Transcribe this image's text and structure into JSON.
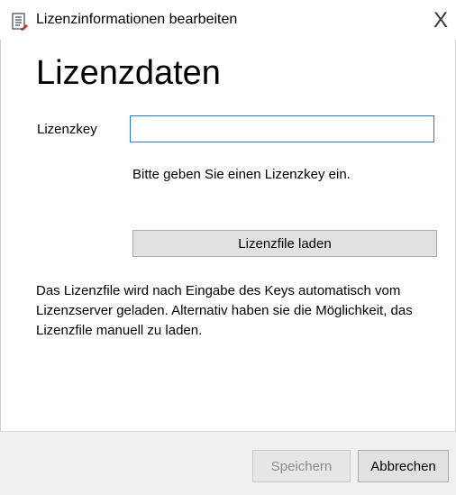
{
  "window": {
    "title": "Lizenzinformationen bearbeiten",
    "close_label": "X"
  },
  "main": {
    "heading": "Lizenzdaten",
    "license_key": {
      "label": "Lizenzkey",
      "value": "",
      "placeholder": ""
    },
    "hint": "Bitte geben Sie einen Lizenzkey ein.",
    "load_button_label": "Lizenzfile laden",
    "description": "Das Lizenzfile wird nach Eingabe des Keys automatisch vom Lizenzserver geladen. Alternativ haben sie die Möglichkeit, das Lizenzfile manuell zu laden."
  },
  "footer": {
    "save_label": "Speichern",
    "save_enabled": false,
    "cancel_label": "Abbrechen"
  },
  "colors": {
    "input_focus_border": "#1e7bd9",
    "button_face": "#e1e1e1",
    "footer_background": "#f0f0f0",
    "disabled_text": "#8c8c8c"
  },
  "icons": {
    "title": "document-edit-icon",
    "close": "close-icon"
  }
}
